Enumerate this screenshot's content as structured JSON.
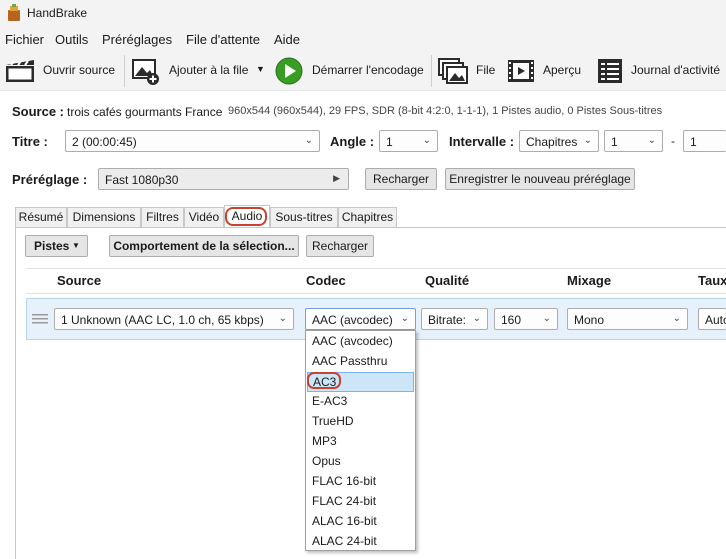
{
  "window": {
    "title": "HandBrake"
  },
  "menu": [
    "Fichier",
    "Outils",
    "Préréglages",
    "File d'attente",
    "Aide"
  ],
  "toolbar": {
    "open_source": "Ouvrir source",
    "add_to_queue": "Ajouter à la file",
    "start_encode": "Démarrer l'encodage",
    "queue": "File",
    "preview": "Aperçu",
    "activity_log": "Journal d'activité"
  },
  "source": {
    "label": "Source :",
    "name": "trois cafés gourmants France",
    "info": "960x544 (960x544), 29 FPS, SDR (8-bit 4:2:0, 1-1-1), 1 Pistes audio, 0 Pistes Sous-titres"
  },
  "title_row": {
    "title_label": "Titre :",
    "title_value": "2  (00:00:45)",
    "angle_label": "Angle :",
    "angle_value": "1",
    "range_label": "Intervalle :",
    "range_mode": "Chapitres",
    "range_start": "1",
    "range_sep": "-",
    "range_end": "1"
  },
  "preset": {
    "label": "Préréglage :",
    "value": "Fast 1080p30",
    "reload": "Recharger",
    "save_new": "Enregistrer le nouveau préréglage"
  },
  "tabs": [
    "Résumé",
    "Dimensions",
    "Filtres",
    "Vidéo",
    "Audio",
    "Sous-titres",
    "Chapitres"
  ],
  "audio": {
    "tracks_button": "Pistes",
    "selection_behavior": "Comportement de la sélection...",
    "reload": "Recharger",
    "columns": [
      "Source",
      "Codec",
      "Qualité",
      "Mixage",
      "Taux"
    ],
    "row": {
      "source": "1 Unknown (AAC LC, 1.0 ch, 65 kbps)",
      "codec": "AAC (avcodec)",
      "quality_mode": "Bitrate:",
      "bitrate": "160",
      "mixdown": "Mono",
      "rate": "Auto"
    },
    "codec_options": [
      "AAC (avcodec)",
      "AAC Passthru",
      "AC3",
      "E-AC3",
      "TrueHD",
      "MP3",
      "Opus",
      "FLAC 16-bit",
      "FLAC 24-bit",
      "ALAC 16-bit",
      "ALAC 24-bit"
    ]
  },
  "colors": {
    "highlight_circle": "#c6432f",
    "start_green": "#3a9d23",
    "row_selected": "#e6f1fb"
  }
}
